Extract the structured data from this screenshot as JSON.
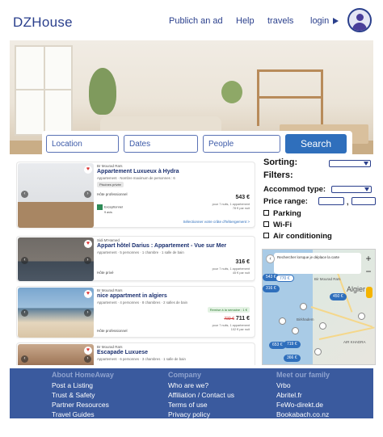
{
  "header": {
    "logo": "DZHouse",
    "nav": {
      "publish": "Publich an ad",
      "help": "Help",
      "travels": "travels",
      "login": "login"
    }
  },
  "search": {
    "location_placeholder": "Location",
    "dates_placeholder": "Dates",
    "people_placeholder": "People",
    "button": "Search"
  },
  "listings": [
    {
      "host": "Br Mourad Raïs",
      "title": "Appartement Luxueux à Hydra",
      "desc": "Appartement · Nombre maximum de personnes : 6",
      "badge": "Piscines privée",
      "pro": "Hôte professionnel",
      "price": "543 €",
      "price_sub1": "pour 7 nuits, 1 appartement",
      "price_sub2": "78 € par nuit",
      "rating": "Exceptionnel",
      "rating_sub": "9 avis",
      "link": "Sélectionner votre crâte d'hébergement >"
    },
    {
      "host": "Sidi M'Hamed",
      "title": "Appart hôtel Darius : Appartement - Vue sur Mer",
      "desc": "Appartement · 5 personnes · 1 chambre · 1 salle de bain",
      "pro": "Hôte privé",
      "price": "316 €",
      "price_sub1": "pour 7 nuits, 1 appartement",
      "price_sub2": "45 € par nuit"
    },
    {
      "host": "Br Mourad Raïs",
      "title": "nice appartment in algiers",
      "desc": "Appartement · 4 personnes · 8 chambres · 2 salles de bain",
      "green": "Remise à la semaine : 1 €",
      "old_price": "722 €",
      "price": "711 €",
      "price_sub1": "pour 7 nuits, 1 appartement",
      "price_sub2": "102 € par nuit",
      "pro": "Hôte professionnel"
    },
    {
      "host": "Br Mourad Raïs",
      "title": "Escapade Luxuese",
      "desc": "Appartement · 6 personnes · 3 chambres · 1 salle de bain"
    }
  ],
  "filters": {
    "sorting": "Sorting:",
    "filters": "Filters:",
    "accommod": "Accommod type:",
    "price_range": "Price range:",
    "price_sep": ",",
    "amenities": [
      "Parking",
      "Wi-Fi",
      "Air conditioning"
    ]
  },
  "map": {
    "tip": "Rechercher lorsque je déplace la carte",
    "city": "Algier",
    "places": [
      "Bir Mourad Raïs",
      "Birkhadem",
      "AIR KHADRA"
    ],
    "pins": [
      "543 €",
      "770 €",
      "450 €",
      "316 €",
      "653 €",
      "719 €",
      "366 €"
    ]
  },
  "footer": {
    "about": {
      "heading": "About HomeAway",
      "items": [
        "Post a Listing",
        "Trust & Safety",
        "Partner Resources",
        "Travel Guides"
      ]
    },
    "company": {
      "heading": "Company",
      "items": [
        "Who are we?",
        "Affiliation / Contact us",
        "Terms of use",
        "Privacy policy"
      ]
    },
    "family": {
      "heading": "Meet our family",
      "items": [
        "Vrbo",
        "Abritel.fr",
        "FeWo-direkt.de",
        "Bookabach.co.nz"
      ]
    }
  },
  "colors": {
    "brand": "#2a3f8c",
    "accent": "#2f6fbc",
    "footer": "#3a5a9e"
  },
  "icons": [
    "heart-icon",
    "chevron-left-icon",
    "chevron-right-icon",
    "play-arrow-icon",
    "user-avatar-icon",
    "checkbox-icon",
    "pegman-icon"
  ]
}
